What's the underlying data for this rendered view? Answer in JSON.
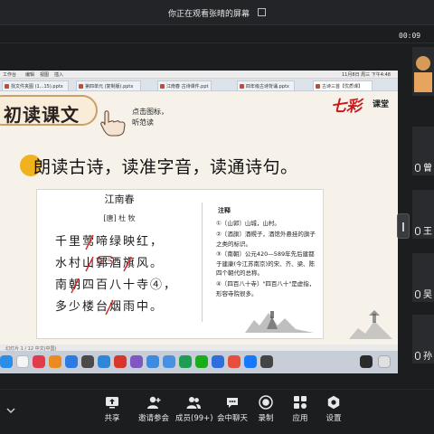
{
  "meeting": {
    "viewing_text": "你正在观看张晴的屏幕",
    "timer": "00:09"
  },
  "mac_menu": {
    "app": "工作台",
    "items": [
      "编辑",
      "视图",
      "插入"
    ],
    "clock": "11月8日 周三 下午4:48"
  },
  "tabs": [
    {
      "label": "找文件夹图 (1...15).pptx"
    },
    {
      "label": "第四单元 (复制版).pptx"
    },
    {
      "label": "江南春 古诗课件.ppt"
    },
    {
      "label": "四年级古诗背诵.pptx"
    },
    {
      "label": "古诗三首【优质课】"
    }
  ],
  "slide": {
    "title": "初读课文",
    "click_hint": [
      "点击图标，",
      "听范读"
    ],
    "logo": "七彩",
    "logo_sub": "课堂",
    "instruction": "朗读古诗，读准字音，读通诗句。",
    "poem": {
      "title": "江南春",
      "author": "[唐] 杜 牧",
      "lines": [
        "千里莺啼绿映红，",
        "水村山郭酒旗风。",
        "南朝四百八十寺④，",
        "多少楼台烟雨中。"
      ],
      "pinyin": "guō"
    },
    "notes_title": "注释",
    "notes": [
      "①〔山郭〕山城，山村。",
      "②〔酒旗〕酒幌子，酒馆外悬挂的旗子之类的标识。",
      "③〔南朝〕公元420—589年先后建都于建康(今江苏南京)的宋、齐、梁、陈四个朝代的总称。",
      "④〔四百八十寺〕\"四百八十\"是虚指，形容寺院很多。"
    ],
    "status": "幻灯片 1 / 12    中文(中国)"
  },
  "participants": [
    {
      "name": ""
    },
    {
      "name": "曾"
    },
    {
      "name": "王"
    },
    {
      "name": "吴"
    },
    {
      "name": "孙"
    }
  ],
  "toolbar": [
    {
      "label": "共享",
      "icon": "share-screen-icon"
    },
    {
      "label": "邀请参会",
      "icon": "invite-icon"
    },
    {
      "label": "成员(99+)",
      "icon": "members-icon"
    },
    {
      "label": "会中聊天",
      "icon": "chat-icon"
    },
    {
      "label": "录制",
      "icon": "record-icon"
    },
    {
      "label": "应用",
      "icon": "apps-icon"
    },
    {
      "label": "设置",
      "icon": "settings-icon"
    }
  ],
  "colors": {
    "accent_red": "#c81a1a",
    "bullet": "#f1b21f",
    "toolbar_bg": "#1c1d1f"
  }
}
